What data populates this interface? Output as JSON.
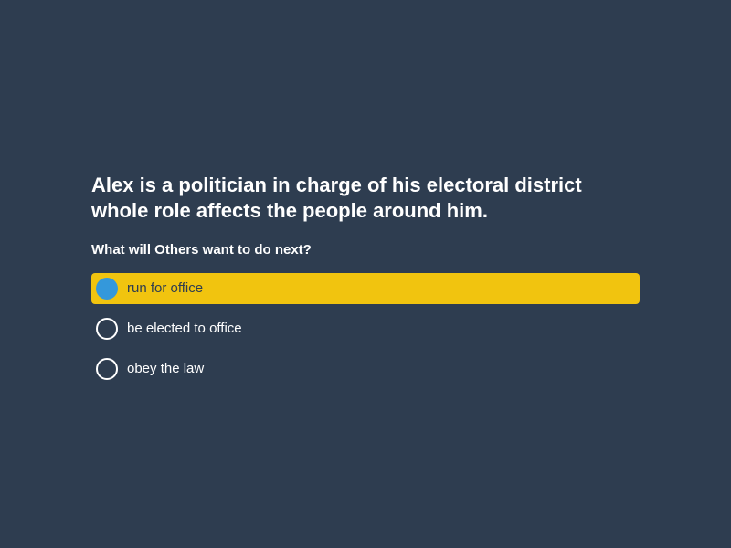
{
  "question": {
    "line1": "Alex is a politician in charge of his electoral district",
    "line2": "whole role affects the people around him."
  },
  "prompt": "What will Others want to do next?",
  "options": [
    {
      "label": "run for office",
      "selected": true
    },
    {
      "label": "be elected to office",
      "selected": false
    },
    {
      "label": "obey the law",
      "selected": false
    }
  ],
  "colors": {
    "background": "#2e3d50",
    "selected_highlight": "#f1c40f",
    "selected_radio": "#3498db",
    "text": "#ffffff"
  }
}
